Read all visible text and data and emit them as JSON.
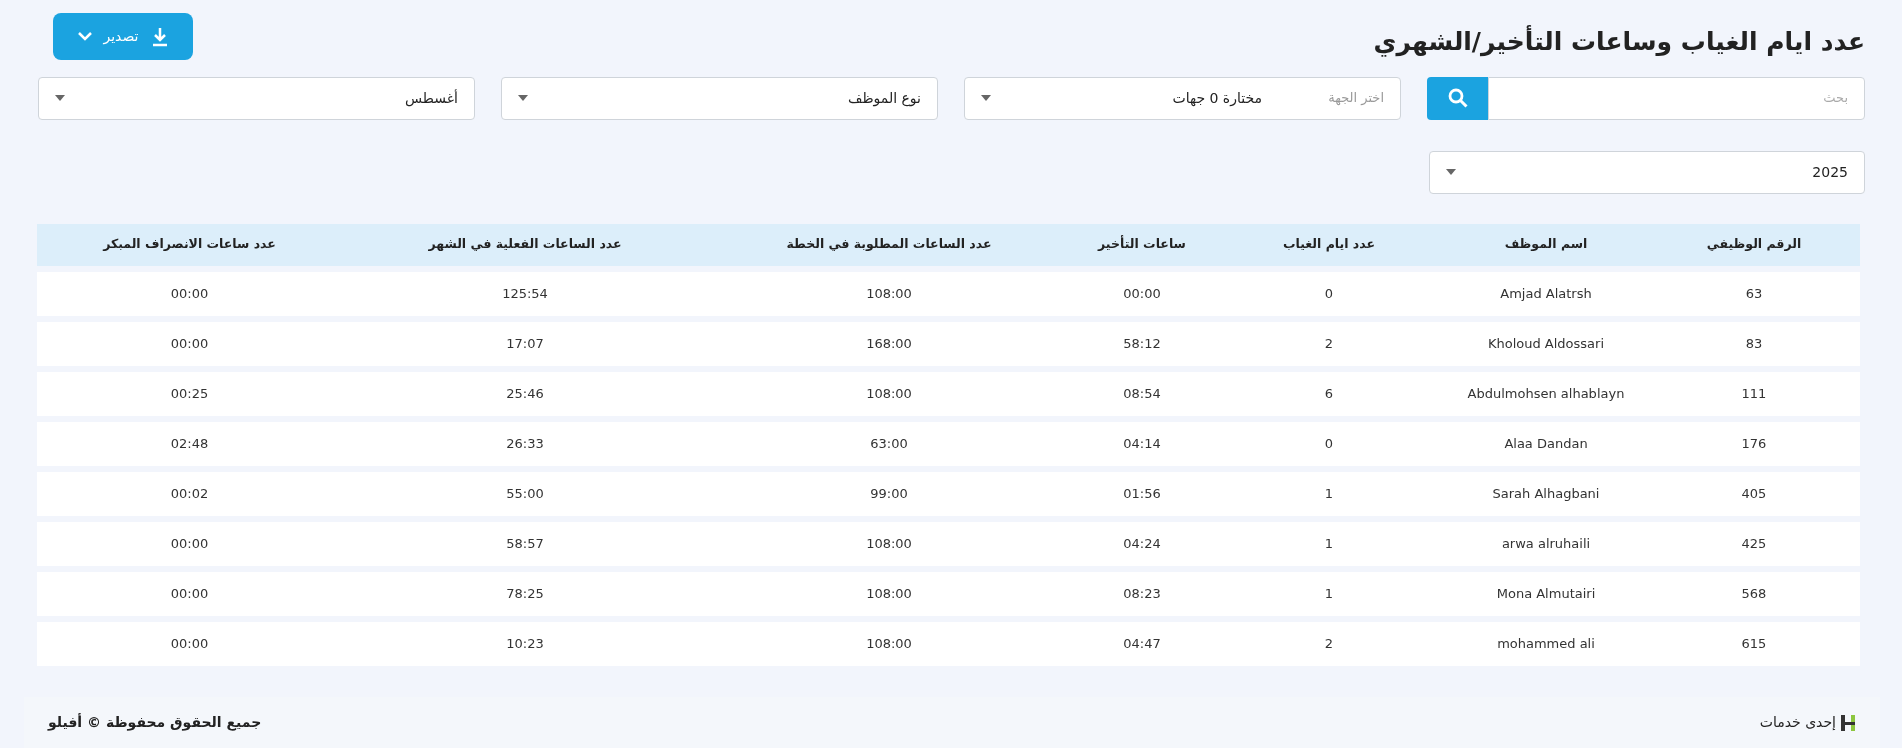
{
  "title": "عدد ايام الغياب وساعات التأخير/الشهري",
  "export_button": {
    "label": "تصدير"
  },
  "filters": {
    "search": {
      "placeholder": "بحث"
    },
    "department": {
      "placeholder": "اختر الجهة",
      "value": "مختارة 0 جهات"
    },
    "employee_type": {
      "value": "نوع الموظف"
    },
    "month": {
      "value": "أغسطس"
    },
    "year": {
      "value": "2025"
    }
  },
  "table": {
    "columns": [
      "عدد ساعات الانصراف المبكر",
      "عدد الساعات الفعلية في الشهر",
      "عدد الساعات المطلوبة في الخطة",
      "ساعات التأخير",
      "عدد ايام الغياب",
      "اسم الموظف",
      "الرقم الوظيفي"
    ],
    "rows": [
      [
        "00:00",
        "125:54",
        "108:00",
        "00:00",
        "0",
        "Amjad Alatrsh",
        "63"
      ],
      [
        "00:00",
        "17:07",
        "168:00",
        "58:12",
        "2",
        "Kholoud Aldossari",
        "83"
      ],
      [
        "00:25",
        "25:46",
        "108:00",
        "08:54",
        "6",
        "Abdulmohsen alhablayn",
        "111"
      ],
      [
        "02:48",
        "26:33",
        "63:00",
        "04:14",
        "0",
        "Alaa Dandan",
        "176"
      ],
      [
        "00:02",
        "55:00",
        "99:00",
        "01:56",
        "1",
        "Sarah Alhagbani",
        "405"
      ],
      [
        "00:00",
        "58:57",
        "108:00",
        "04:24",
        "1",
        "arwa alruhaili",
        "425"
      ],
      [
        "00:00",
        "78:25",
        "108:00",
        "08:23",
        "1",
        "Mona Almutairi",
        "568"
      ],
      [
        "00:00",
        "10:23",
        "108:00",
        "04:47",
        "2",
        "mohammed ali",
        "615"
      ]
    ]
  },
  "footer": {
    "service": "إحدى خدمات",
    "copyright": "جميع الحقوق محفوظة © أفيلو"
  }
}
